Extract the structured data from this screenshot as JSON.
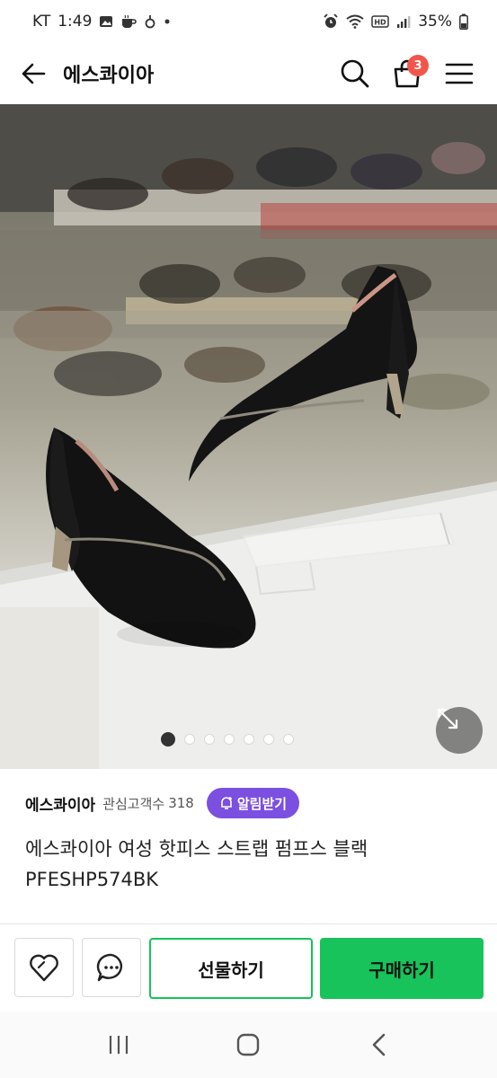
{
  "status_bar": {
    "carrier": "KT",
    "time": "1:49",
    "battery": "35%"
  },
  "header": {
    "title": "에스콰이아",
    "cart_count": "3"
  },
  "gallery": {
    "total_images": 7,
    "active_index": 0
  },
  "seller": {
    "name": "에스콰이아",
    "followers_label": "관심고객수",
    "followers_count": "318",
    "alarm_label": "알림받기"
  },
  "product": {
    "title": "에스콰이아 여성 핫피스 스트랩 펌프스 블랙 PFESHP574BK"
  },
  "actions": {
    "gift_label": "선물하기",
    "buy_label": "구매하기"
  },
  "colors": {
    "accent_green": "#17c35a",
    "alarm_purple": "#7b4fe0",
    "badge_red": "#f2564b"
  }
}
